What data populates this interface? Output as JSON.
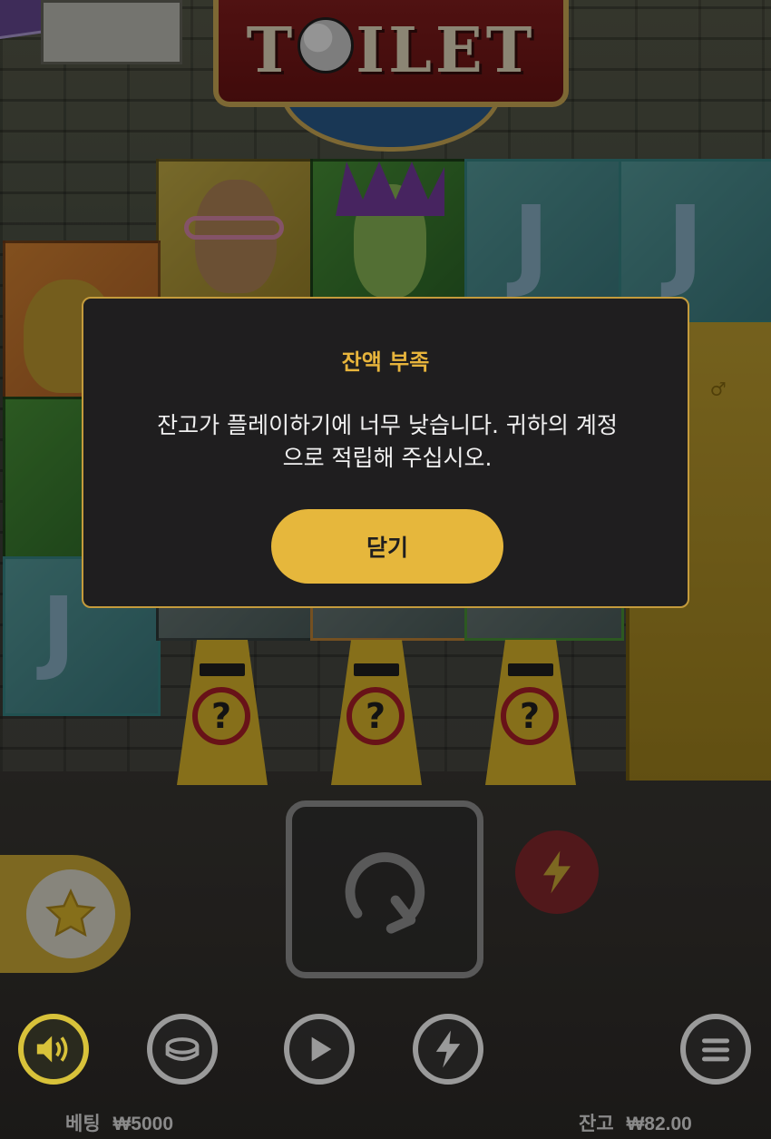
{
  "game": {
    "logo_text": [
      "T",
      "ILET"
    ]
  },
  "reels": {
    "mystery_symbol": "?"
  },
  "dialog": {
    "title": "잔액 부족",
    "message": "잔고가 플레이하기에 너무 낮습니다. 귀하의 계정\n으로 적립해 주십시오.",
    "close_label": "닫기"
  },
  "controls": {
    "spin_icon": "spin-arrow-icon",
    "turbo_icon": "lightning-icon",
    "favorite_icon": "star-icon",
    "sound_icon": "speaker-icon",
    "coin_icon": "coin-icon",
    "autoplay_icon": "play-icon",
    "quick_icon": "lightning-icon",
    "menu_icon": "hamburger-icon"
  },
  "status": {
    "bet_label": "베팅",
    "bet_value": "₩5000",
    "balance_label": "잔고",
    "balance_value": "₩82.00"
  },
  "colors": {
    "accent": "#e6b73c",
    "dialog_bg": "#1f1e1f",
    "turbo": "#8c2a2f"
  }
}
